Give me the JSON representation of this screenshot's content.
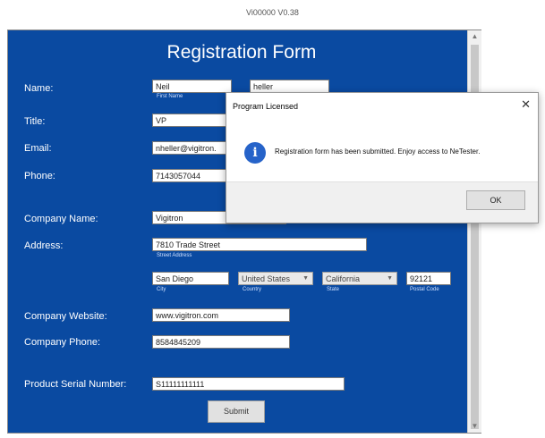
{
  "window_title": "Vi00000 V0.38",
  "form": {
    "title": "Registration Form",
    "labels": {
      "name": "Name:",
      "title": "Title:",
      "email": "Email:",
      "phone": "Phone:",
      "company_name": "Company Name:",
      "address": "Address:",
      "company_website": "Company Website:",
      "company_phone": "Company Phone:",
      "product_serial": "Product Serial Number:"
    },
    "fields": {
      "first_name": "Neil",
      "last_name": "heller",
      "title": "VP",
      "email": "nheller@vigitron.",
      "phone": "7143057044",
      "company_name": "Vigitron",
      "street_address": "7810 Trade Street",
      "city": "San Diego",
      "country": "United States",
      "state": "California",
      "postal_code": "92121",
      "company_website": "www.vigitron.com",
      "company_phone": "8584845209",
      "product_serial": "S11111111111"
    },
    "sublabels": {
      "first_name": "First Name",
      "street_address": "Street Address",
      "city": "City",
      "country": "Country",
      "state": "State",
      "postal_code": "Postal Code"
    },
    "submit_label": "Submit"
  },
  "dialog": {
    "title": "Program Licensed",
    "close": "✕",
    "icon": "info-icon",
    "message": "Registration form has been submitted. Enjoy access to NeTester.",
    "ok_label": "OK"
  },
  "colors": {
    "form_background": "#0a4aa1",
    "info_icon": "#2663c9"
  }
}
